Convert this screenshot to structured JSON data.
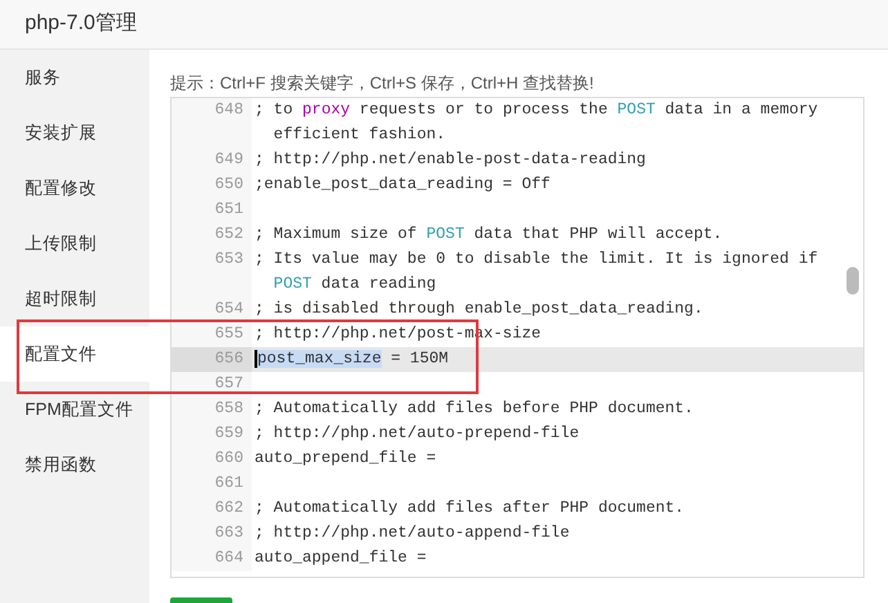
{
  "window": {
    "title": "php-7.0管理"
  },
  "sidebar": {
    "items": [
      {
        "label": "服务",
        "selected": false
      },
      {
        "label": "安装扩展",
        "selected": false
      },
      {
        "label": "配置修改",
        "selected": false
      },
      {
        "label": "上传限制",
        "selected": false
      },
      {
        "label": "超时限制",
        "selected": false
      },
      {
        "label": "配置文件",
        "selected": true
      },
      {
        "label": "FPM配置文件",
        "selected": false
      },
      {
        "label": "禁用函数",
        "selected": false
      }
    ]
  },
  "hint": "提示：Ctrl+F 搜索关键字，Ctrl+S 保存，Ctrl+H 查找替换!",
  "editor": {
    "lines": [
      {
        "number": "648",
        "active": false,
        "segments": [
          {
            "kind": "comment",
            "text": "; to "
          },
          {
            "kind": "keyword",
            "text": "proxy"
          },
          {
            "kind": "comment",
            "text": " requests or to process the "
          },
          {
            "kind": "builtin",
            "text": "POST"
          },
          {
            "kind": "comment",
            "text": " data in a memory efficient fashion."
          }
        ]
      },
      {
        "number": "649",
        "active": false,
        "segments": [
          {
            "kind": "comment",
            "text": "; http://php.net/enable-post-data-reading"
          }
        ]
      },
      {
        "number": "650",
        "active": false,
        "segments": [
          {
            "kind": "comment",
            "text": ";enable_post_data_reading = Off"
          }
        ]
      },
      {
        "number": "651",
        "active": false
      },
      {
        "number": "652",
        "active": false,
        "segments": [
          {
            "kind": "comment",
            "text": "; Maximum size of "
          },
          {
            "kind": "builtin",
            "text": "POST"
          },
          {
            "kind": "comment",
            "text": " data that PHP will accept."
          }
        ]
      },
      {
        "number": "653",
        "active": false,
        "segments": [
          {
            "kind": "comment",
            "text": "; Its value may be 0 to disable the limit. It is ignored if "
          },
          {
            "kind": "builtin",
            "text": "POST"
          },
          {
            "kind": "comment",
            "text": " data reading"
          }
        ]
      },
      {
        "number": "654",
        "active": false,
        "segments": [
          {
            "kind": "comment",
            "text": "; is disabled through enable_post_data_reading."
          }
        ]
      },
      {
        "number": "655",
        "active": false,
        "segments": [
          {
            "kind": "comment",
            "text": "; http://php.net/post-max-size"
          }
        ]
      },
      {
        "number": "656",
        "active": true,
        "segments": [
          {
            "kind": "selection",
            "text": "post_max_size"
          },
          {
            "kind": "plain",
            "text": " = 150M"
          }
        ]
      },
      {
        "number": "657",
        "active": false
      },
      {
        "number": "658",
        "active": false,
        "segments": [
          {
            "kind": "comment",
            "text": "; Automatically add files before PHP document."
          }
        ]
      },
      {
        "number": "659",
        "active": false,
        "segments": [
          {
            "kind": "comment",
            "text": "; http://php.net/auto-prepend-file"
          }
        ]
      },
      {
        "number": "660",
        "active": false,
        "segments": [
          {
            "kind": "plain",
            "text": "auto_prepend_file ="
          }
        ]
      },
      {
        "number": "661",
        "active": false
      },
      {
        "number": "662",
        "active": false,
        "segments": [
          {
            "kind": "comment",
            "text": "; Automatically add files after PHP document."
          }
        ]
      },
      {
        "number": "663",
        "active": false,
        "segments": [
          {
            "kind": "comment",
            "text": "; http://php.net/auto-append-file"
          }
        ]
      },
      {
        "number": "664",
        "active": false,
        "segments": [
          {
            "kind": "plain",
            "text": "auto_append_file ="
          }
        ]
      }
    ]
  }
}
